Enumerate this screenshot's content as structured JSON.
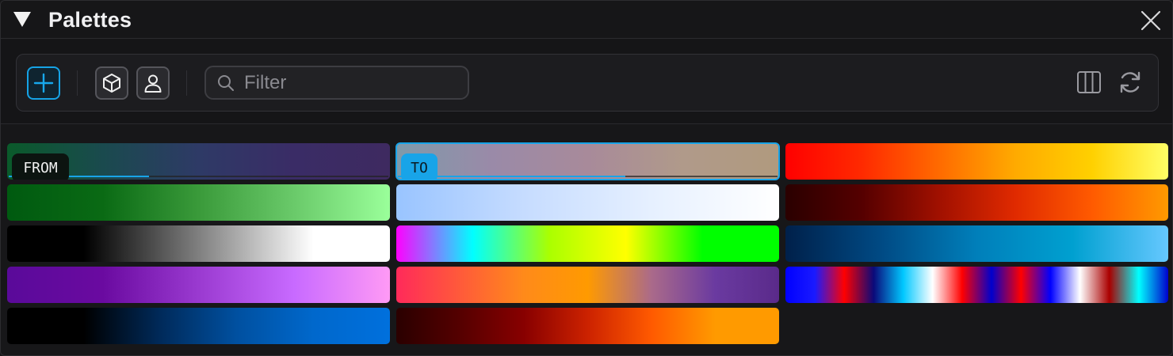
{
  "panel": {
    "title": "Palettes"
  },
  "toolbar": {
    "add_icon": "plus-icon",
    "cube_icon": "cube-icon",
    "user_icon": "user-icon",
    "search_icon": "search-icon",
    "columns_icon": "columns-icon",
    "refresh_icon": "refresh-icon",
    "accent_color": "#16a3e6"
  },
  "search": {
    "placeholder": "Filter",
    "value": ""
  },
  "labels": {
    "from": "FROM",
    "to": "TO"
  },
  "palettes": [
    {
      "id": "p1",
      "gradient": [
        "#0a5a2a",
        "#1a4a4e",
        "#2e3a66",
        "#3a2c66",
        "#3e2a60"
      ],
      "tag": "from",
      "progress": 0.37
    },
    {
      "id": "p2",
      "gradient": [
        "#7f9aaa",
        "#9a8aa8",
        "#a88a9a",
        "#b09a8a",
        "#b09a7e"
      ],
      "tag": "to",
      "progress": 0.6,
      "selected": true
    },
    {
      "id": "p3",
      "gradient": [
        "#ff0000",
        "#ff2a00",
        "#ff6a00",
        "#ffaa00",
        "#ffd000",
        "#ffff66"
      ]
    },
    {
      "id": "p4",
      "gradient": [
        "#005a10",
        "#0a6a14",
        "#3a9a3a",
        "#6aca6a",
        "#9aff9a"
      ]
    },
    {
      "id": "p5",
      "gradient": [
        "#99c4ff",
        "#c6dcff",
        "#e6f0ff",
        "#ffffff"
      ]
    },
    {
      "id": "p6",
      "gradient": [
        "#2a0000",
        "#550000",
        "#a01000",
        "#e02a00",
        "#ff5a00",
        "#ff9a00"
      ]
    },
    {
      "id": "p7",
      "gradient": [
        "#000000",
        "#000000",
        "#555555",
        "#aaaaaa",
        "#ffffff",
        "#ffffff"
      ]
    },
    {
      "id": "p8",
      "gradient": [
        "#ff00ff",
        "#00ffff",
        "#aaff00",
        "#ffff00",
        "#00ff00",
        "#00ff00"
      ]
    },
    {
      "id": "p9",
      "gradient": [
        "#00204a",
        "#004a84",
        "#007fba",
        "#00a0d0",
        "#66c8ff"
      ]
    },
    {
      "id": "p10",
      "gradient": [
        "#5a0a9a",
        "#6a0aa0",
        "#9a3ad0",
        "#c86aff",
        "#ff9af5"
      ]
    },
    {
      "id": "p11",
      "gradient": [
        "#ff2a5a",
        "#ff5a3a",
        "#ff8a1a",
        "#ff9a00",
        "#aa6a8a",
        "#6a3aa0",
        "#5a2a8a"
      ]
    },
    {
      "id": "p12",
      "gradient": [
        "#0000ff",
        "#1a1aff",
        "#ff0000",
        "#0a0a7a",
        "#00c8ff",
        "#ffffff",
        "#ff0000",
        "#0000cc",
        "#ff0000",
        "#0000ff",
        "#ffffff",
        "#aa0000",
        "#00ffff",
        "#0000cc"
      ]
    },
    {
      "id": "p13",
      "gradient": [
        "#000000",
        "#000000",
        "#002a5a",
        "#0050a0",
        "#0068cc",
        "#0070dd"
      ]
    },
    {
      "id": "p14",
      "gradient": [
        "#2a0000",
        "#550000",
        "#880000",
        "#cc2200",
        "#ff5a00",
        "#ff9a00",
        "#ff9a00"
      ]
    }
  ]
}
